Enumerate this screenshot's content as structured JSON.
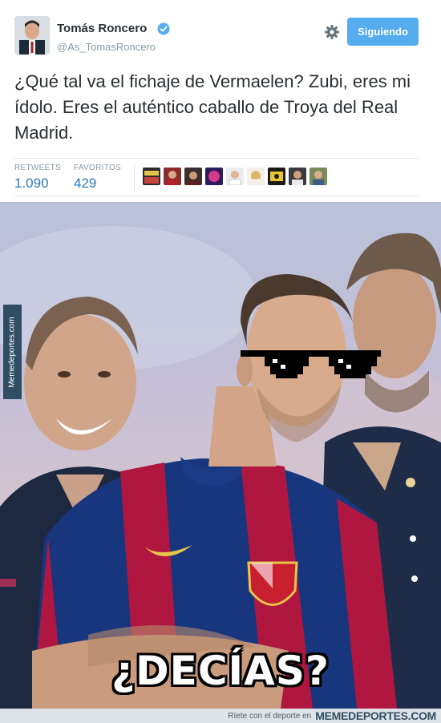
{
  "tweet": {
    "display_name": "Tomás Roncero",
    "screen_name": "@As_TomasRoncero",
    "follow_button_label": "Siguiendo",
    "text": "¿Qué tal va el fichaje de Vermaelen? Zubi, eres mi ídolo. Eres el auténtico caballo de Troya del Real Madrid.",
    "stats": {
      "retweets_label": "RETWEETS",
      "retweets_value": "1.090",
      "favorites_label": "FAVORITOS",
      "favorites_value": "429"
    },
    "favoriter_avatars": [
      "avatar-1",
      "avatar-2",
      "avatar-3",
      "avatar-4",
      "avatar-5",
      "avatar-6",
      "avatar-7",
      "avatar-8",
      "avatar-9"
    ],
    "icons": [
      "verified-icon",
      "gear-icon"
    ],
    "colors": {
      "follow_button": "#55acee",
      "stat_value": "#2b7bb9",
      "muted": "#8899a6"
    }
  },
  "meme": {
    "side_watermark": "Memedeportes.com",
    "caption": "¿DECÍAS?"
  },
  "footer": {
    "tagline": "Ríete con el deporte en",
    "brand": "MEMEDEPORTES.COM"
  }
}
